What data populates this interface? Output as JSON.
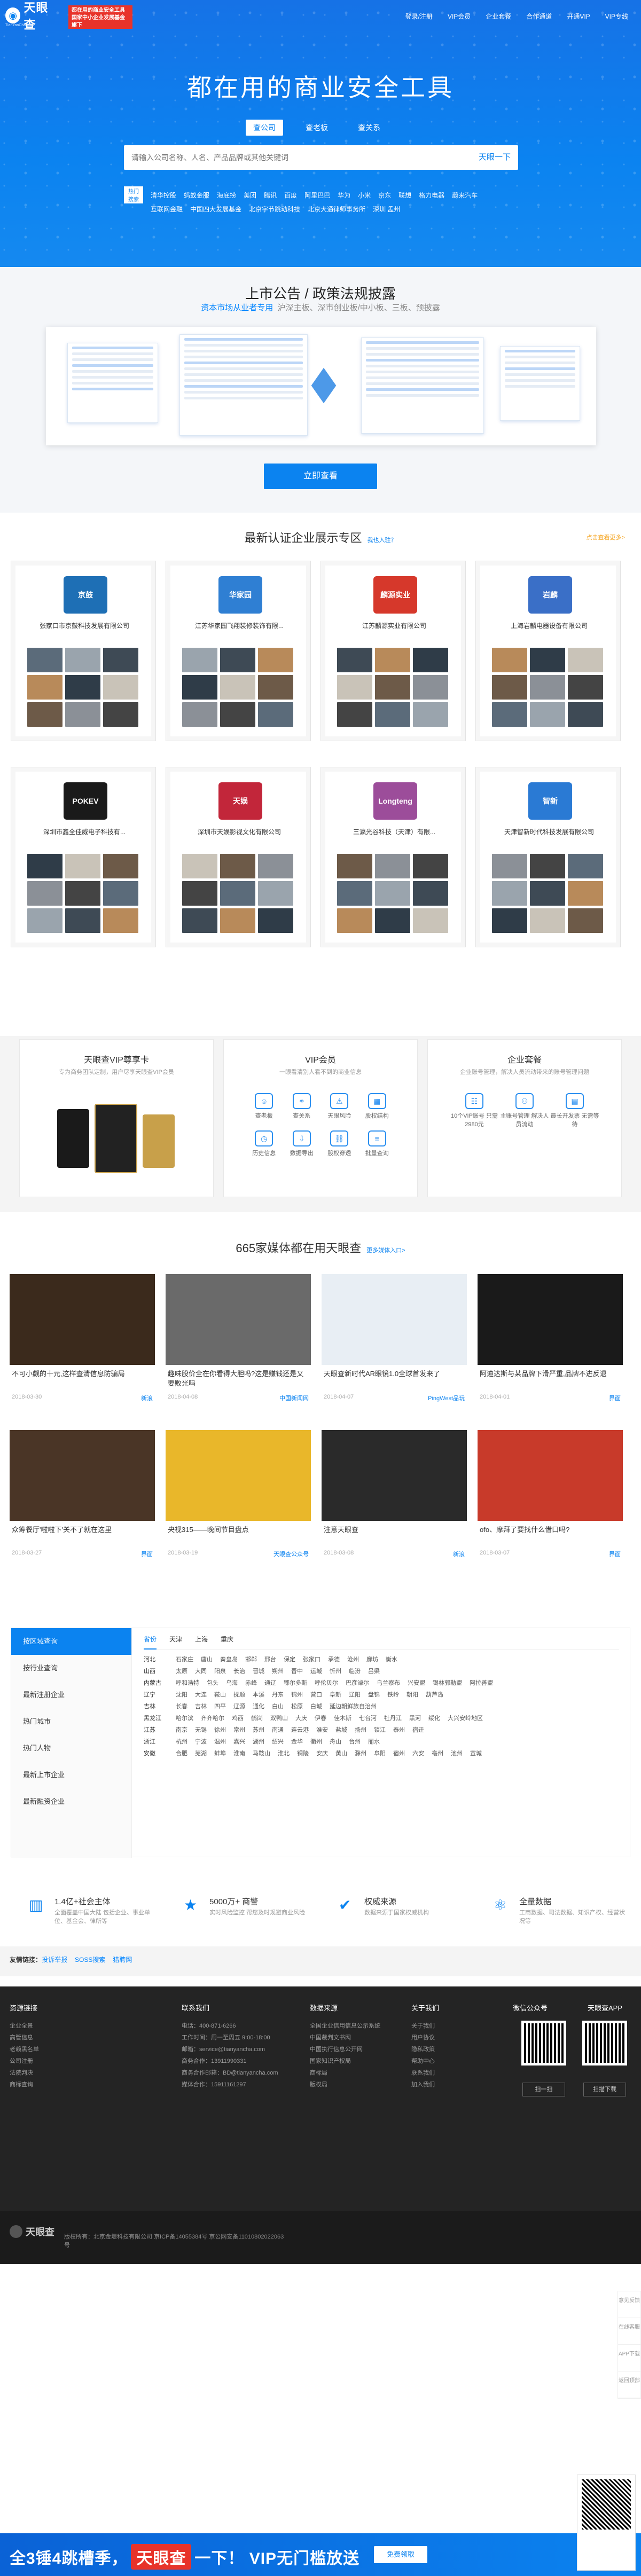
{
  "header": {
    "logo_text": "天眼查",
    "logo_sub": "TianYanCha.com",
    "slogan": "都在用的商业安全工具 国家中小企业发展基金旗下",
    "nav": [
      "登录/注册",
      "VIP会员",
      "企业套餐",
      "合作通道",
      "开通VIP",
      "VIP专线"
    ],
    "title": "都在用的商业安全工具",
    "tabs": [
      "查公司",
      "查老板",
      "查关系"
    ],
    "search_placeholder": "请输入公司名称、人名、产品品牌或其他关键词",
    "search_button": "天眼一下",
    "hot_label": "热门搜索",
    "hot_rows": [
      [
        "清华控股",
        "蚂蚁金服",
        "海底捞",
        "美团",
        "腾讯",
        "百度",
        "阿里巴巴",
        "华为",
        "小米",
        "京东",
        "联想",
        "格力电器",
        "蔚来汽车"
      ],
      [
        "互联网金融",
        "中国四大发展基金",
        "北京字节跳动科技",
        "北京大通律师事务所",
        "深圳 孟州"
      ]
    ]
  },
  "announcement": {
    "title": "上市公告 / 政策法规披露",
    "subtitle_highlight": "资本市场从业者专用",
    "subtitle_rest": "沪深主板、深市创业板/中小板、三板、预披露",
    "button": "立即查看"
  },
  "enterprise": {
    "title": "最新认证企业展示专区",
    "title_link": "我也入驻？",
    "right_link": "点击查看更多>",
    "cards": [
      {
        "name": "张家口市京鼓科技发展有限公司",
        "logo": "京鼓",
        "color": "#1e6fb5"
      },
      {
        "name": "江苏华家园飞翔装修装饰有限...",
        "logo": "华家园",
        "color": "#2f7fd3"
      },
      {
        "name": "江苏麟源实业有限公司",
        "logo": "麟源实业",
        "color": "#d6382b"
      },
      {
        "name": "上海岩麟电器设备有限公司",
        "logo": "岩麟",
        "color": "#3a6fc7"
      },
      {
        "name": "深圳市鑫全佳威电子科技有...",
        "logo": "POKEV",
        "color": "#1a1a1a"
      },
      {
        "name": "深圳市天娱影视文化有限公司",
        "logo": "天娱",
        "color": "#c2263a"
      },
      {
        "name": "三瀛光谷科技（天津）有限...",
        "logo": "Longteng",
        "color": "#9c4d9a"
      },
      {
        "name": "天津智新时代科技发展有限公司",
        "logo": "智新",
        "color": "#2a7ad4"
      }
    ]
  },
  "vip": {
    "cards": [
      {
        "title": "天眼查VIP尊享卡",
        "sub": "专为商务团队定制，用户尽享天眼查VIP会员"
      },
      {
        "title": "VIP会员",
        "sub": "一眼看清别人看不到的商业信息",
        "items": [
          "查老板",
          "查关系",
          "天眼风险",
          "股权结构",
          "历史信息",
          "数据导出",
          "股权穿透",
          "批量查询"
        ]
      },
      {
        "title": "企业套餐",
        "sub": "企业账号管理，解决人员流动带来的账号管理问题",
        "items": [
          "10个VIP账号 只需2980元",
          "主账号管理 解决人员流动",
          "最长开发票 无需等待"
        ]
      }
    ]
  },
  "media": {
    "title": "665家媒体都在用天眼查",
    "title_link": "更多媒体入口>",
    "items": [
      {
        "caption": "不可小觑的十元,这样查清信息防骗局",
        "date": "2018-03-30",
        "src": "新浪"
      },
      {
        "caption": "趣味股价全在你看得大胆吗?这是赚钱还是又要败光吗",
        "date": "2018-04-08",
        "src": "中国新闻网"
      },
      {
        "caption": "天眼查新时代AR眼镜1.0全球首发来了",
        "date": "2018-04-07",
        "src": "PingWest品玩"
      },
      {
        "caption": "阿迪达斯与某品牌下滑严重,品牌不进反退",
        "date": "2018-04-01",
        "src": "界面"
      },
      {
        "caption": "众筹餐厅'啦啦下'关不了就在这里",
        "date": "2018-03-27",
        "src": "界面"
      },
      {
        "caption": "央视315——晚间节目盘点",
        "date": "2018-03-19",
        "src": "天眼查公众号"
      },
      {
        "caption": "注意天眼查",
        "date": "2018-03-08",
        "src": "新浪"
      },
      {
        "caption": "ofo、摩拜了要找什么借口吗?",
        "date": "2018-03-07",
        "src": "界面"
      }
    ]
  },
  "regions": {
    "side": [
      "按区域查询",
      "按行业查询",
      "最新注册企业",
      "热门城市",
      "热门人物",
      "最新上市企业",
      "最新融资企业"
    ],
    "tabs": [
      "省份",
      "天津",
      "上海",
      "重庆"
    ],
    "rows": [
      {
        "prov": "河北",
        "cities": [
          "石家庄",
          "唐山",
          "秦皇岛",
          "邯郸",
          "邢台",
          "保定",
          "张家口",
          "承德",
          "沧州",
          "廊坊",
          "衡水"
        ]
      },
      {
        "prov": "山西",
        "cities": [
          "太原",
          "大同",
          "阳泉",
          "长治",
          "晋城",
          "朔州",
          "晋中",
          "运城",
          "忻州",
          "临汾",
          "吕梁"
        ]
      },
      {
        "prov": "内蒙古",
        "cities": [
          "呼和浩特",
          "包头",
          "乌海",
          "赤峰",
          "通辽",
          "鄂尔多斯",
          "呼伦贝尔",
          "巴彦淖尔",
          "乌兰察布",
          "兴安盟",
          "锡林郭勒盟",
          "阿拉善盟"
        ]
      },
      {
        "prov": "辽宁",
        "cities": [
          "沈阳",
          "大连",
          "鞍山",
          "抚顺",
          "本溪",
          "丹东",
          "锦州",
          "营口",
          "阜新",
          "辽阳",
          "盘锦",
          "铁岭",
          "朝阳",
          "葫芦岛"
        ]
      },
      {
        "prov": "吉林",
        "cities": [
          "长春",
          "吉林",
          "四平",
          "辽源",
          "通化",
          "白山",
          "松原",
          "白城",
          "延边朝鲜族自治州"
        ]
      },
      {
        "prov": "黑龙江",
        "cities": [
          "哈尔滨",
          "齐齐哈尔",
          "鸡西",
          "鹤岗",
          "双鸭山",
          "大庆",
          "伊春",
          "佳木斯",
          "七台河",
          "牡丹江",
          "黑河",
          "绥化",
          "大兴安岭地区"
        ]
      },
      {
        "prov": "江苏",
        "cities": [
          "南京",
          "无锡",
          "徐州",
          "常州",
          "苏州",
          "南通",
          "连云港",
          "淮安",
          "盐城",
          "扬州",
          "镇江",
          "泰州",
          "宿迁"
        ]
      },
      {
        "prov": "浙江",
        "cities": [
          "杭州",
          "宁波",
          "温州",
          "嘉兴",
          "湖州",
          "绍兴",
          "金华",
          "衢州",
          "舟山",
          "台州",
          "丽水"
        ]
      },
      {
        "prov": "安徽",
        "cities": [
          "合肥",
          "芜湖",
          "蚌埠",
          "淮南",
          "马鞍山",
          "淮北",
          "铜陵",
          "安庆",
          "黄山",
          "滁州",
          "阜阳",
          "宿州",
          "六安",
          "亳州",
          "池州",
          "宣城"
        ]
      }
    ]
  },
  "features": [
    {
      "title": "1.4亿+社会主体",
      "desc": "全面覆盖中国大陆 包括企业、事业单位、基金会、律所等"
    },
    {
      "title": "5000万+ 商警",
      "desc": "实时风险监控 帮您及时规避商业风险"
    },
    {
      "title": "权威来源",
      "desc": "数据来源于国家权威机构"
    },
    {
      "title": "全量数据",
      "desc": "工商数据、司法数据、知识产权、经营状况等"
    }
  ],
  "links": {
    "label": "友情链接：",
    "items": [
      "投诉举报",
      "SOSS搜索",
      "猎聘网"
    ]
  },
  "footer": {
    "cols": [
      {
        "title": "资源链接",
        "items": [
          "企业全景",
          "高管信息",
          "老赖黑名单",
          "公司注册",
          "法院判决",
          "商标查询"
        ]
      },
      {
        "title": "联系我们",
        "items": [
          "电话：400-871-6266",
          "工作时间：周一至周五 9:00-18:00",
          "邮箱：service@tianyancha.com",
          "商务合作：13911990331",
          "商务合作邮箱：BD@tianyancha.com",
          "媒体合作：15911161297"
        ]
      },
      {
        "title": "数据来源",
        "items": [
          "全国企业信用信息公示系统",
          "中国裁判文书网",
          "中国执行信息公开网",
          "国家知识产权局",
          "商标局",
          "版权局"
        ]
      },
      {
        "title": "关于我们",
        "items": [
          "关于我们",
          "用户协议",
          "隐私政策",
          "帮助中心",
          "联系我们",
          "加入我们"
        ]
      }
    ],
    "wechat_title": "微信公众号",
    "app_title": "天眼查APP",
    "btn1": "扫一扫",
    "btn2": "扫描下载",
    "copyright": "版权所有：北京金堤科技有限公司 京ICP备14055384号 京公网安备11010802022063号"
  },
  "side_float": [
    "意见反馈",
    "在线客服",
    "APP下载",
    "返回顶部"
  ],
  "bottom_banner": {
    "text_a": "全3锤4跳槽季，",
    "logo": "天眼查",
    "text_b": "一下！ VIP无门槛放送",
    "button": "免费领取"
  }
}
